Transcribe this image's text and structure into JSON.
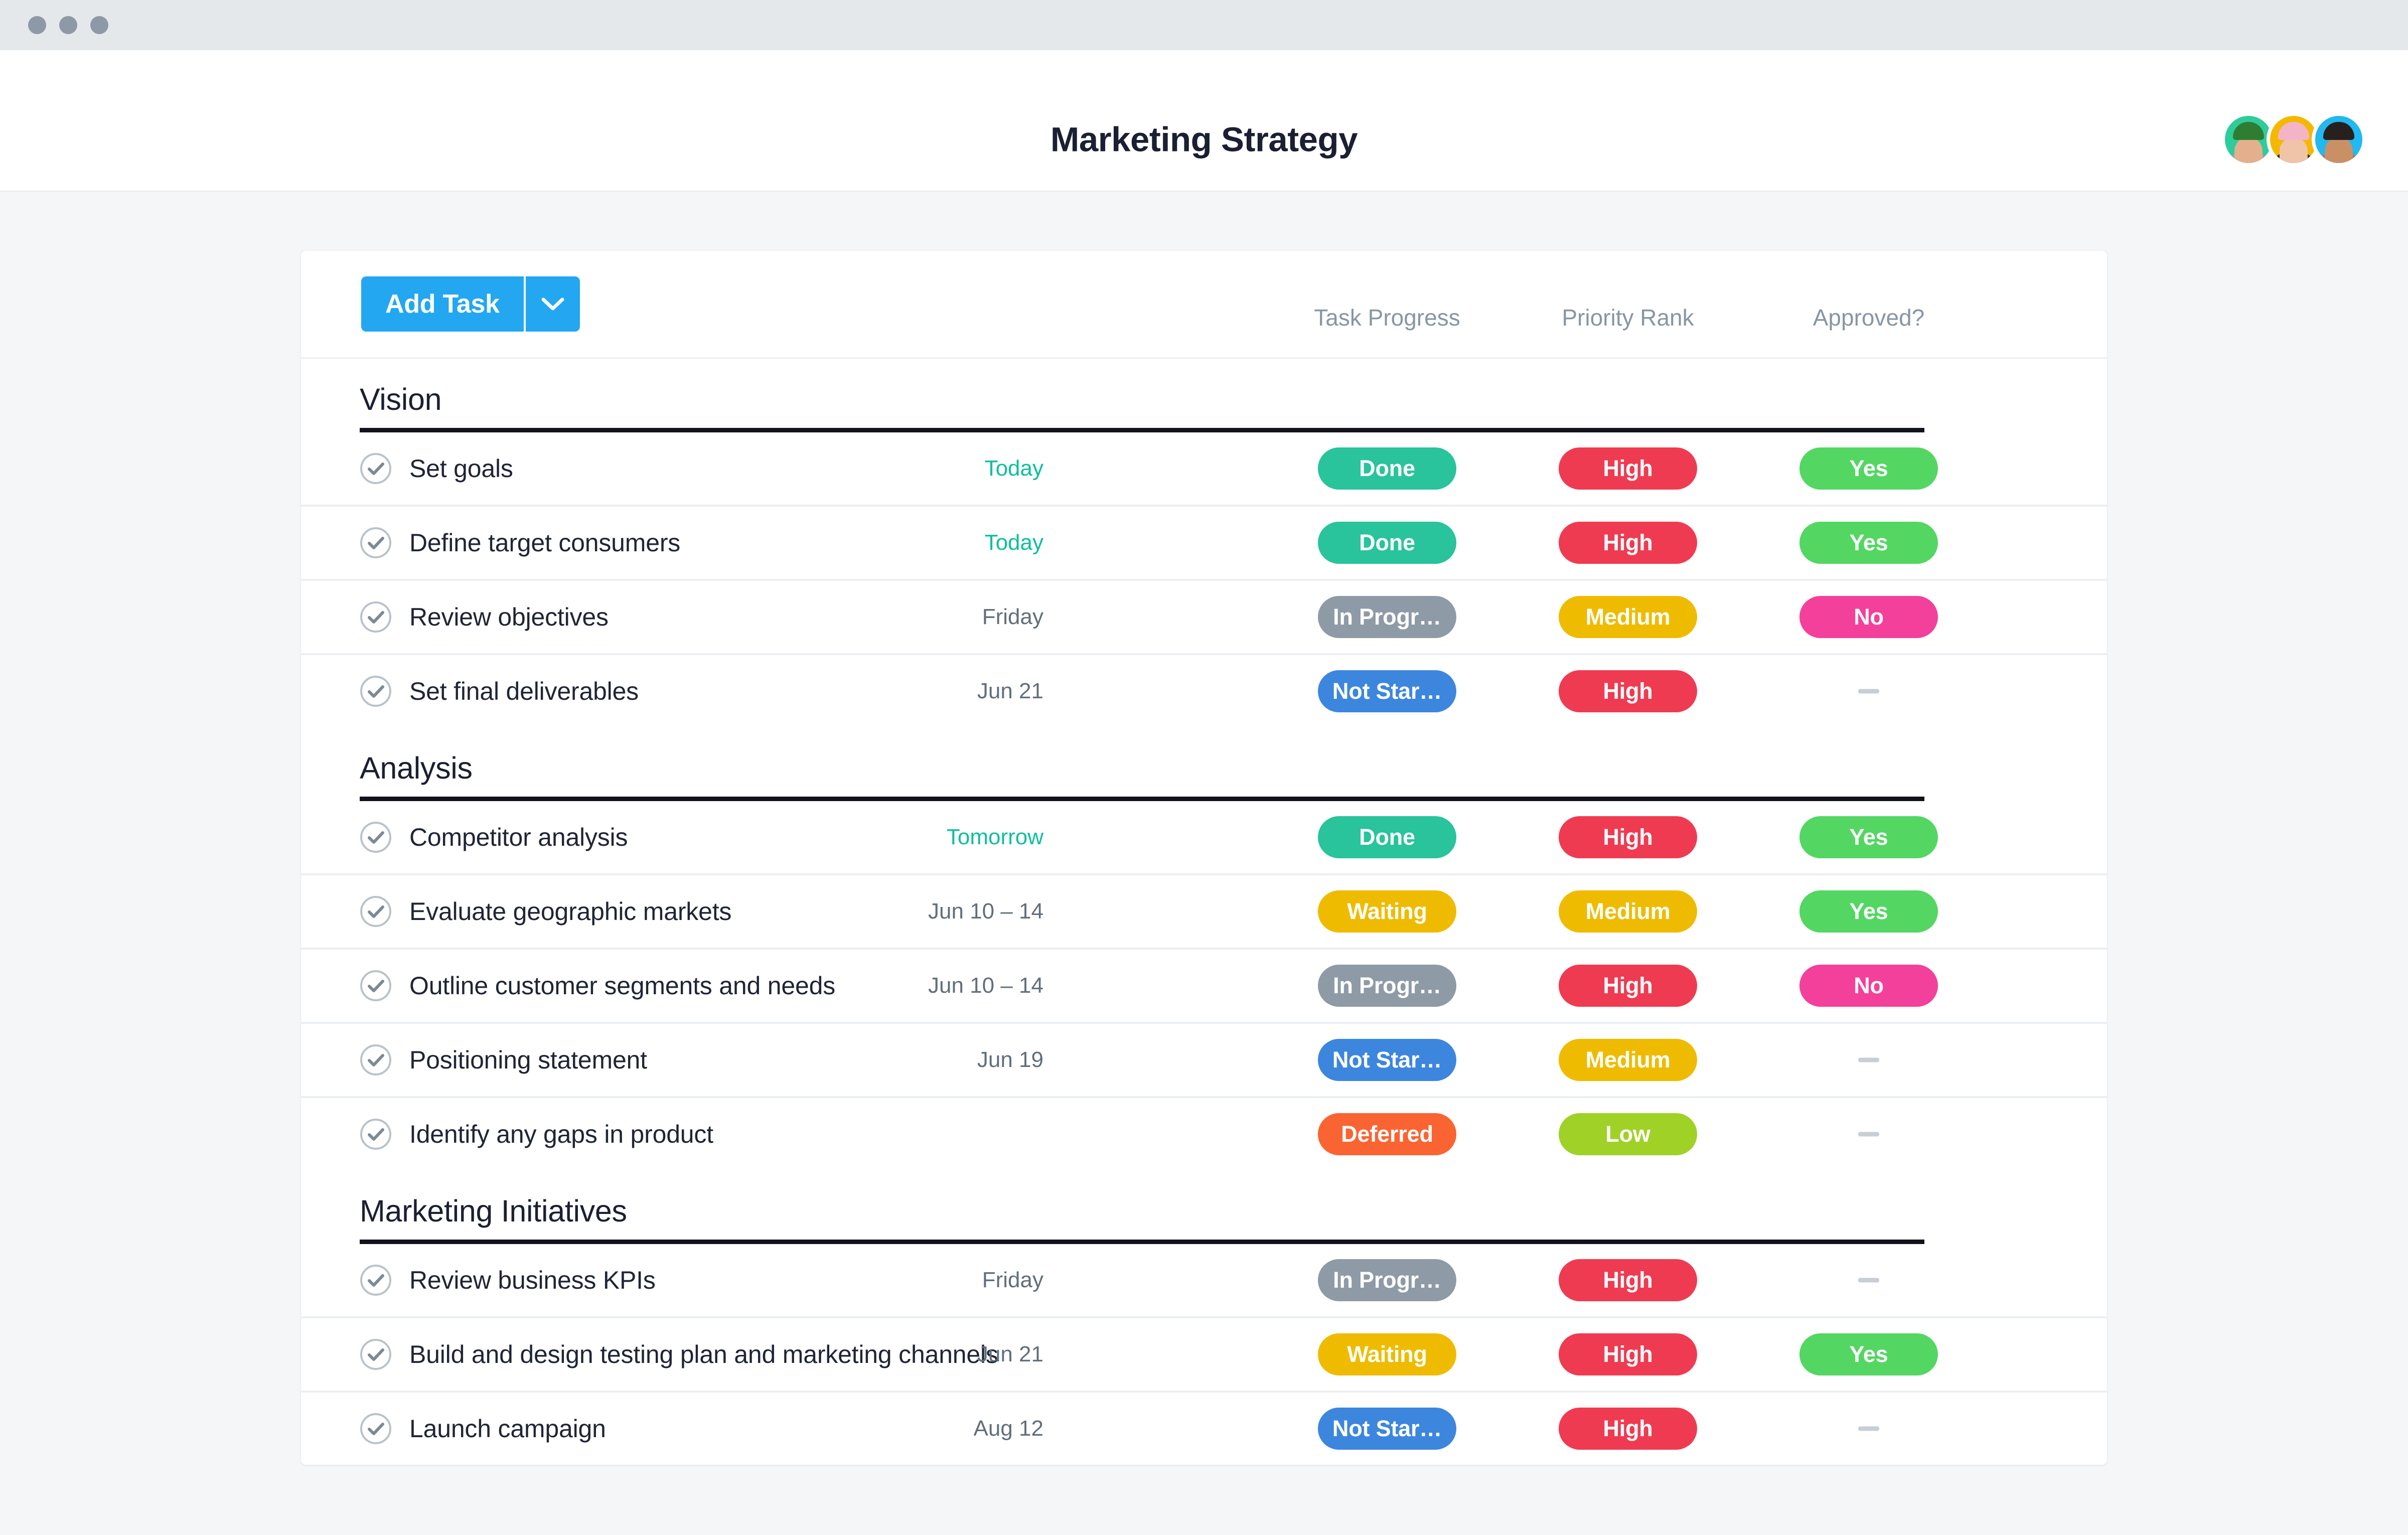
{
  "window": {
    "traffic_lights": [
      "close-dot",
      "minimize-dot",
      "maximize-dot"
    ]
  },
  "header": {
    "title": "Marketing Strategy",
    "avatars": [
      {
        "name": "avatar-1",
        "bg": "#2ecc9b",
        "hair": "#2f7d32",
        "shirt": "#9aa3ac",
        "skin": "#e3b08d"
      },
      {
        "name": "avatar-2",
        "bg": "#f5b800",
        "hair": "#f4b4c8",
        "shirt": "#2a3138",
        "skin": "#f0c4a8"
      },
      {
        "name": "avatar-3",
        "bg": "#22b8f0",
        "hair": "#26211f",
        "shirt": "#9a7d7a",
        "skin": "#c99066"
      }
    ]
  },
  "toolbar": {
    "add_task_label": "Add Task",
    "caret_icon": "chevron-down-icon",
    "accent_color": "#22a7f0",
    "columns": [
      "Task Progress",
      "Priority Rank",
      "Approved?"
    ]
  },
  "colors": {
    "done": "#29c39c",
    "in_progress": "#8e9ba6",
    "not_started": "#3d86de",
    "waiting": "#efbb00",
    "deferred": "#fa6432",
    "high": "#ef3b51",
    "medium": "#efbb00",
    "low": "#a0d127",
    "yes": "#54d663",
    "no": "#f3409a",
    "due_soon": "#0dbf9b",
    "due_normal": "#616e7c"
  },
  "sections": [
    {
      "title": "Vision",
      "rows": [
        {
          "name": "Set goals",
          "due": "Today",
          "due_soon": true,
          "progress": {
            "label": "Done",
            "color": "#29c39c"
          },
          "priority": {
            "label": "High",
            "color": "#ef3b51"
          },
          "approved": {
            "label": "Yes",
            "color": "#54d663"
          }
        },
        {
          "name": "Define target consumers",
          "due": "Today",
          "due_soon": true,
          "progress": {
            "label": "Done",
            "color": "#29c39c"
          },
          "priority": {
            "label": "High",
            "color": "#ef3b51"
          },
          "approved": {
            "label": "Yes",
            "color": "#54d663"
          }
        },
        {
          "name": "Review objectives",
          "due": "Friday",
          "due_soon": false,
          "progress": {
            "label": "In Progr…",
            "color": "#8e9ba6"
          },
          "priority": {
            "label": "Medium",
            "color": "#efbb00"
          },
          "approved": {
            "label": "No",
            "color": "#f3409a"
          }
        },
        {
          "name": "Set final deliverables",
          "due": "Jun 21",
          "due_soon": false,
          "progress": {
            "label": "Not Star…",
            "color": "#3d86de"
          },
          "priority": {
            "label": "High",
            "color": "#ef3b51"
          },
          "approved": {
            "label": "",
            "color": ""
          }
        }
      ]
    },
    {
      "title": "Analysis",
      "rows": [
        {
          "name": "Competitor analysis",
          "due": "Tomorrow",
          "due_soon": true,
          "progress": {
            "label": "Done",
            "color": "#29c39c"
          },
          "priority": {
            "label": "High",
            "color": "#ef3b51"
          },
          "approved": {
            "label": "Yes",
            "color": "#54d663"
          }
        },
        {
          "name": "Evaluate geographic markets",
          "due": "Jun 10 – 14",
          "due_soon": false,
          "progress": {
            "label": "Waiting",
            "color": "#efbb00"
          },
          "priority": {
            "label": "Medium",
            "color": "#efbb00"
          },
          "approved": {
            "label": "Yes",
            "color": "#54d663"
          }
        },
        {
          "name": "Outline customer segments and needs",
          "due": "Jun 10 – 14",
          "due_soon": false,
          "progress": {
            "label": "In Progr…",
            "color": "#8e9ba6"
          },
          "priority": {
            "label": "High",
            "color": "#ef3b51"
          },
          "approved": {
            "label": "No",
            "color": "#f3409a"
          }
        },
        {
          "name": "Positioning statement",
          "due": "Jun 19",
          "due_soon": false,
          "progress": {
            "label": "Not Star…",
            "color": "#3d86de"
          },
          "priority": {
            "label": "Medium",
            "color": "#efbb00"
          },
          "approved": {
            "label": "",
            "color": ""
          }
        },
        {
          "name": "Identify any gaps in product",
          "due": "",
          "due_soon": false,
          "progress": {
            "label": "Deferred",
            "color": "#fa6432"
          },
          "priority": {
            "label": "Low",
            "color": "#a0d127"
          },
          "approved": {
            "label": "",
            "color": ""
          }
        }
      ]
    },
    {
      "title": "Marketing Initiatives",
      "rows": [
        {
          "name": "Review business KPIs",
          "due": "Friday",
          "due_soon": false,
          "progress": {
            "label": "In Progr…",
            "color": "#8e9ba6"
          },
          "priority": {
            "label": "High",
            "color": "#ef3b51"
          },
          "approved": {
            "label": "",
            "color": ""
          }
        },
        {
          "name": "Build and design testing plan and marketing channels",
          "due": "Jun 21",
          "due_soon": false,
          "progress": {
            "label": "Waiting",
            "color": "#efbb00"
          },
          "priority": {
            "label": "High",
            "color": "#ef3b51"
          },
          "approved": {
            "label": "Yes",
            "color": "#54d663"
          }
        },
        {
          "name": "Launch campaign",
          "due": "Aug 12",
          "due_soon": false,
          "progress": {
            "label": "Not Star…",
            "color": "#3d86de"
          },
          "priority": {
            "label": "High",
            "color": "#ef3b51"
          },
          "approved": {
            "label": "",
            "color": ""
          }
        }
      ]
    }
  ]
}
